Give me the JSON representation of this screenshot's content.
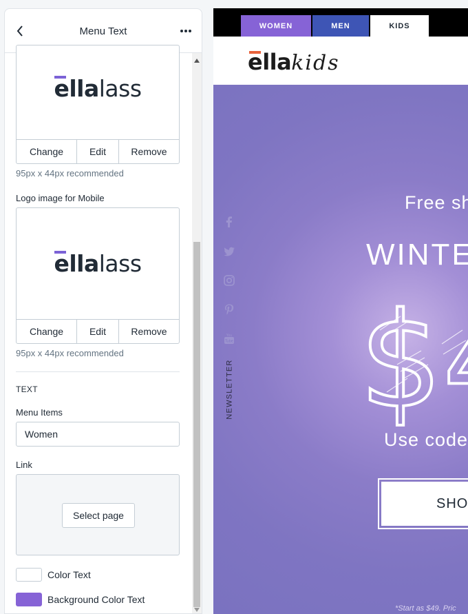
{
  "sidebar": {
    "title": "Menu Text",
    "desktop_logo": {
      "logo_text_bold": "ella",
      "logo_text_light": "lass",
      "change_label": "Change",
      "edit_label": "Edit",
      "remove_label": "Remove",
      "hint": "95px x 44px recommended"
    },
    "mobile_logo": {
      "label": "Logo image for Mobile",
      "logo_text_bold": "ella",
      "logo_text_light": "lass",
      "change_label": "Change",
      "edit_label": "Edit",
      "remove_label": "Remove",
      "hint": "95px x 44px recommended"
    },
    "text_section": {
      "heading": "TEXT",
      "menu_items_label": "Menu Items",
      "menu_items_value": "Women",
      "link_label": "Link",
      "select_page_label": "Select page",
      "color_text_label": "Color Text",
      "color_text_value": "#ffffff",
      "bg_color_text_label": "Background Color Text",
      "bg_color_text_value": "#8663d6"
    }
  },
  "preview": {
    "tabs": [
      {
        "label": "WOMEN",
        "color": "#8663d6"
      },
      {
        "label": "MEN",
        "color": "#3e55b5"
      },
      {
        "label": "KIDS",
        "color": "#ffffff"
      }
    ],
    "brand": {
      "bold": "ella",
      "script": "kids",
      "accent": "#e8623b"
    },
    "social_icons": [
      "facebook-icon",
      "twitter-icon",
      "instagram-icon",
      "pinterest-icon",
      "youtube-icon"
    ],
    "newsletter_label": "NEWSLETTER",
    "hero": {
      "line1": "Free sh",
      "line2": "WINTE",
      "big_text": "$4",
      "line3": "Use code:",
      "button_label": "SHO",
      "footnote": "*Start as $49. Pric"
    }
  }
}
